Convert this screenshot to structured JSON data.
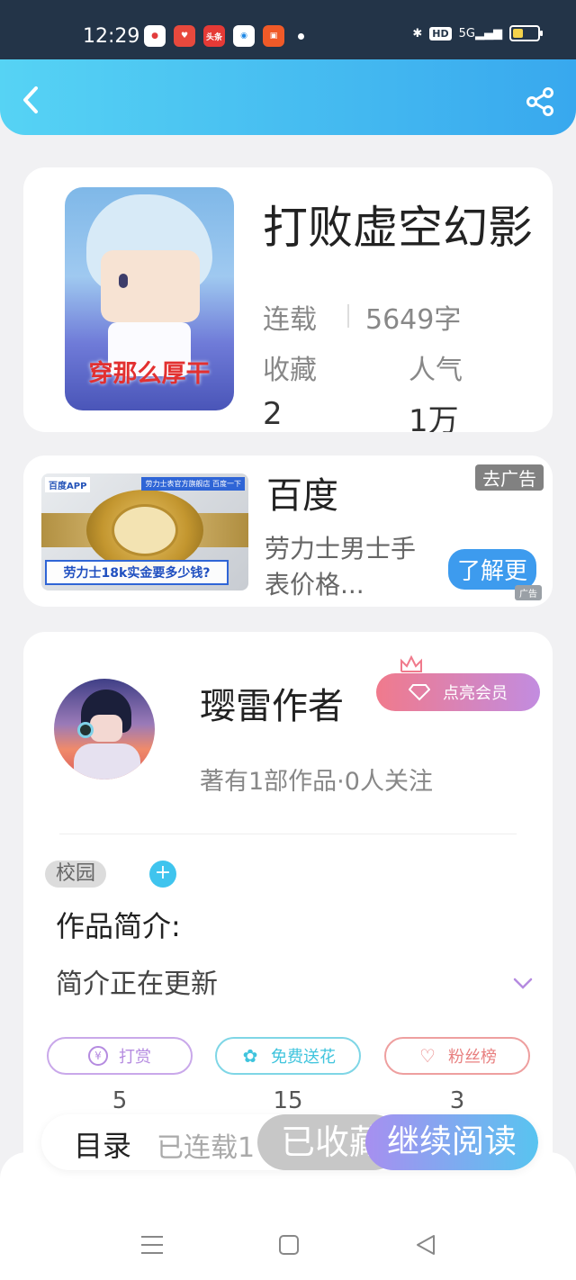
{
  "status_bar": {
    "time": "12:29",
    "apps": [
      {
        "name": "baidu-app-icon",
        "color": "#e23c3c",
        "label": ""
      },
      {
        "name": "heart-app-icon",
        "color": "#e8493d",
        "label": ""
      },
      {
        "name": "toutiao-app-icon",
        "color": "#e53a36",
        "label": "头条"
      },
      {
        "name": "browser-app-icon",
        "color": "#1e88e5",
        "label": ""
      },
      {
        "name": "video-app-icon",
        "color": "#f05a28",
        "label": ""
      }
    ],
    "hd_label": "HD",
    "network_label": "5G",
    "battery_level": 0.35
  },
  "book": {
    "title": "打败虚空幻影",
    "status": "连载",
    "word_count": "5649字",
    "favorites_label": "收藏",
    "favorites_value": "2",
    "popularity_label": "人气",
    "popularity_value": "1万",
    "cover_caption": "穿那么厚干"
  },
  "ad": {
    "image_tag": "百度APP",
    "image_banner": "劳力士表官方旗舰店 百度一下",
    "image_promo": "劳力士18k实金要多少钱?",
    "source": "百度",
    "description": "劳力士男士手表价格...",
    "close_label": "去广告",
    "cta": "了解更",
    "ad_mark": "广告"
  },
  "author": {
    "name": "璎雷作者",
    "vip_label": "点亮会员",
    "stats": "著有1部作品·0人关注"
  },
  "work": {
    "tag": "校园",
    "tag_add": "+",
    "intro_title": "作品简介:",
    "intro_text": "简介正在更新"
  },
  "actions": [
    {
      "label": "打赏",
      "value": "5",
      "color": "#b58be0",
      "icon": "¥"
    },
    {
      "label": "免费送花",
      "value": "15",
      "color": "#3fc4dd",
      "icon": "✿"
    },
    {
      "label": "粉丝榜",
      "value": "3",
      "color": "#e88080",
      "icon": "♡"
    }
  ],
  "bottom_bar": {
    "toc": "目录",
    "serial": "已连载1",
    "collected": "已收藏",
    "continue": "继续阅读"
  }
}
